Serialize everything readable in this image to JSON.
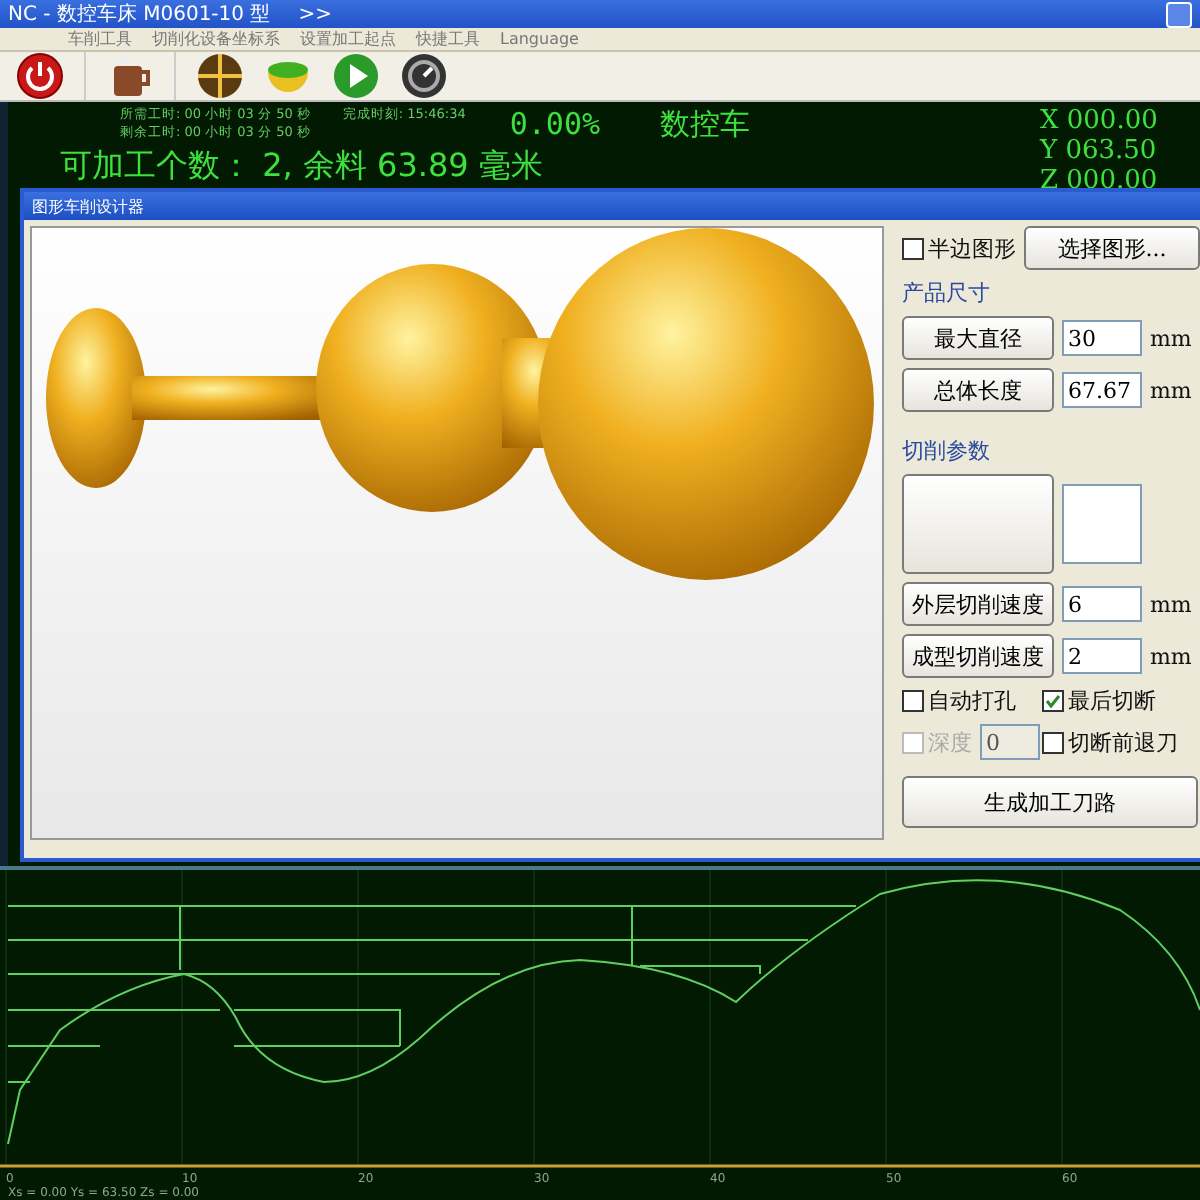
{
  "window": {
    "title": "NC - 数控车床 M0601-10 型",
    "more": ">>"
  },
  "menu": [
    "车削工具",
    "切削化设备坐标系",
    "设置加工起点",
    "快捷工具",
    "Language"
  ],
  "status": {
    "times": [
      {
        "label": "所需工时:",
        "value": "00 小时 03 分 50 秒"
      },
      {
        "label": "剩余工时:",
        "value": "00 小时 03 分 50 秒"
      }
    ],
    "finish": {
      "label": "完成时刻:",
      "value": "15:46:34"
    },
    "percent": "0.00%",
    "machine": "数控车",
    "count_line": "可加工个数： 2, 余料 63.89 毫米",
    "coords": [
      {
        "axis": "X",
        "value": "000.00"
      },
      {
        "axis": "Y",
        "value": "063.50"
      },
      {
        "axis": "Z",
        "value": "000.00"
      }
    ]
  },
  "dialog": {
    "title": "图形车削设计器",
    "half_shape": {
      "label": "半边图形",
      "checked": false
    },
    "select_button": "选择图形...",
    "size_section": "产品尺寸",
    "size_rows": [
      {
        "button": "最大直径",
        "value": "30",
        "unit": "mm"
      },
      {
        "button": "总体长度",
        "value": "67.67",
        "unit": "mm"
      }
    ],
    "cut_section": "切削参数",
    "cut_rows": [
      {
        "button": "外层切削速度",
        "value": "6",
        "unit": "mm"
      },
      {
        "button": "成型切削速度",
        "value": "2",
        "unit": "mm"
      }
    ],
    "options": [
      {
        "label": "自动打孔",
        "checked": false,
        "disabled": false
      },
      {
        "label": "最后切断",
        "checked": true,
        "disabled": false
      },
      {
        "label": "深度",
        "checked": false,
        "disabled": true,
        "value": "0"
      },
      {
        "label": "切断前退刀",
        "checked": false,
        "disabled": false
      }
    ],
    "generate_button": "生成加工刀路"
  },
  "plot": {
    "ticks": [
      "0",
      "10",
      "20",
      "30",
      "40",
      "50",
      "60"
    ],
    "status_line": "Xs = 0.00  Ys = 63.50  Zs = 0.00"
  }
}
